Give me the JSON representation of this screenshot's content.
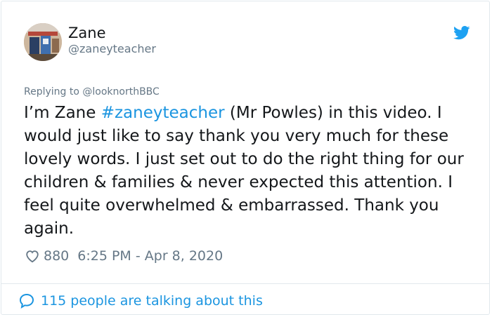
{
  "tweet": {
    "author": {
      "display_name": "Zane",
      "handle": "@zaneyteacher",
      "avatar_icon": "profile-photo"
    },
    "platform_icon": "twitter-bird-icon",
    "brand_color": "#1da1f2",
    "link_color": "#1b95e0",
    "replying_to_label": "Replying to",
    "replying_to_handle": "@looknorthBBC",
    "text_before_hashtag": "I’m Zane ",
    "hashtag": "#zaneyteacher",
    "text_after_hashtag": " (Mr Powles) in this video. I would just like to say thank you very much for these lovely words. I just set out to do the right thing for our children & families & never expected this attention. I feel quite overwhelmed & embarrassed. Thank you again.",
    "like_count": "880",
    "timestamp": "6:25 PM - Apr 8, 2020",
    "talking_label": "115 people are talking about this"
  }
}
